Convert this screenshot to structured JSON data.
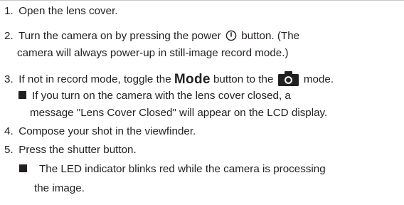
{
  "steps": [
    {
      "number": "1.",
      "text": "Open the lens cover."
    },
    {
      "number": "2.",
      "text_before_icon": "Turn the camera on by pressing the power",
      "icon": "power-icon",
      "text_after_icon": "button.  (The",
      "continuation": "camera will always power-up in still-image record mode.)"
    },
    {
      "number": "3.",
      "text_before_mode": "If not in record mode, toggle the",
      "mode_word": "Mode",
      "text_after_mode": "button to the",
      "icon": "camera-icon",
      "text_after_icon": "mode.",
      "note": {
        "line1": "If you turn on the camera with the lens cover closed, a",
        "line2": "message \"Lens Cover Closed\" will appear on the LCD display."
      }
    },
    {
      "number": "4.",
      "text": "Compose your shot in the viewfinder."
    },
    {
      "number": "5.",
      "text": "Press the shutter button.",
      "note": {
        "line1": "The LED indicator blinks red while the camera is processing",
        "line2": "the image."
      }
    }
  ],
  "colors": {
    "text": "#231f20",
    "rule": "#c8c8c8",
    "background": "#ffffff"
  }
}
